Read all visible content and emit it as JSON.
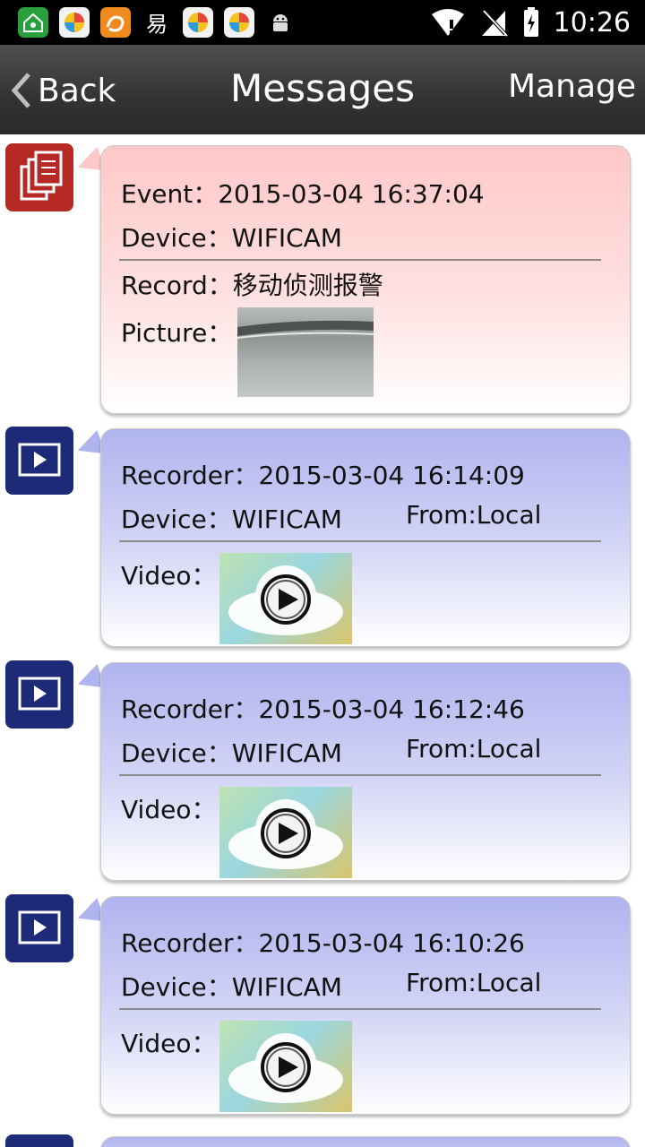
{
  "status_bar": {
    "time": "10:26",
    "app_icons": [
      "home-icon",
      "app-store-icon",
      "uc-browser-icon",
      "yi-icon",
      "app-store-icon",
      "app-store-icon",
      "android-icon"
    ]
  },
  "title_bar": {
    "back_label": "Back",
    "title": "Messages",
    "manage_label": "Manage"
  },
  "messages": [
    {
      "kind": "event",
      "icon": "alarm-record-icon",
      "event_label": "Event：",
      "event_time": "2015-03-04 16:37:04",
      "device_label": "Device：",
      "device": "WIFICAM",
      "record_label": "Record：",
      "record": "移动侦测报警",
      "picture_label": "Picture："
    },
    {
      "kind": "video",
      "icon": "video-play-icon",
      "recorder_label": "Recorder：",
      "recorder_time": "2015-03-04 16:14:09",
      "device_label": "Device：",
      "device": "WIFICAM",
      "from": "From:Local",
      "video_label": "Video："
    },
    {
      "kind": "video",
      "icon": "video-play-icon",
      "recorder_label": "Recorder：",
      "recorder_time": "2015-03-04 16:12:46",
      "device_label": "Device：",
      "device": "WIFICAM",
      "from": "From:Local",
      "video_label": "Video："
    },
    {
      "kind": "video",
      "icon": "video-play-icon",
      "recorder_label": "Recorder：",
      "recorder_time": "2015-03-04 16:10:26",
      "device_label": "Device：",
      "device": "WIFICAM",
      "from": "From:Local",
      "video_label": "Video："
    }
  ],
  "colors": {
    "event_icon_bg": "#b52a24",
    "video_icon_bg": "#1c2a78",
    "event_bubble": "#ffc8c8",
    "video_bubble": "#b0b4ee"
  }
}
